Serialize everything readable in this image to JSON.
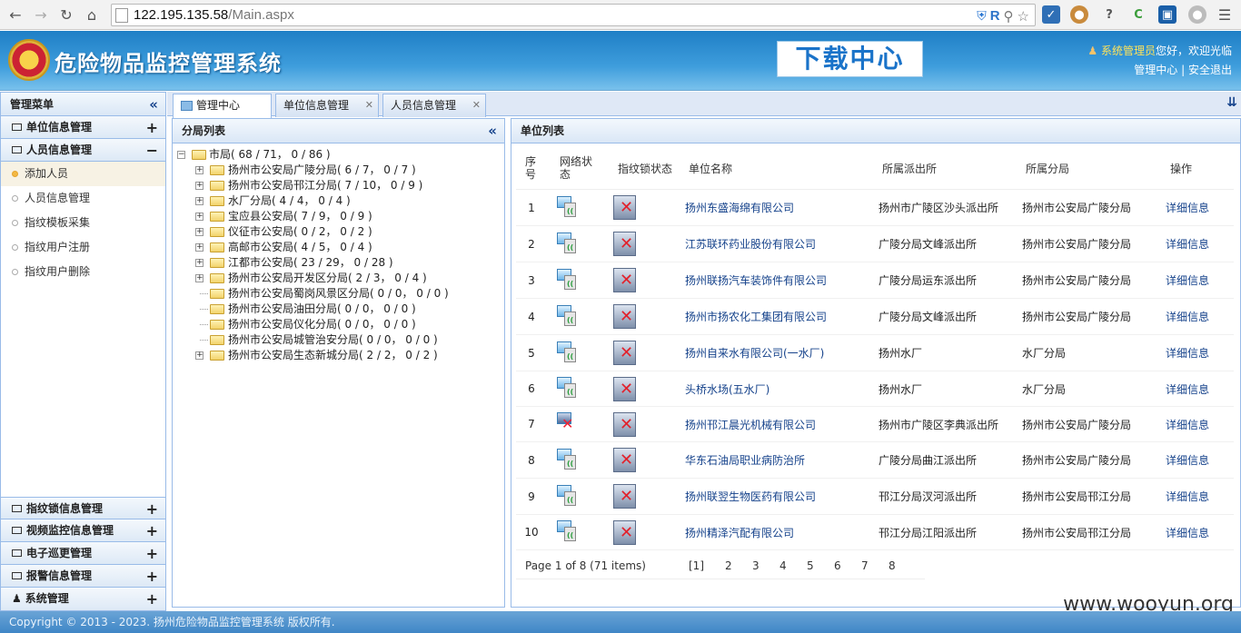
{
  "browser": {
    "url_host": "122.195.135.58",
    "url_path": "/Main.aspx"
  },
  "header": {
    "system_title": "危险物品监控管理系统",
    "download_center": "下载中心",
    "user_name": "系统管理员",
    "greeting": "您好，欢迎光临",
    "manage_center": "管理中心",
    "separator": "|",
    "logout": "安全退出"
  },
  "sidebar": {
    "title": "管理菜单",
    "sections": [
      {
        "label": "单位信息管理",
        "state": "+"
      },
      {
        "label": "人员信息管理",
        "state": "−"
      }
    ],
    "subitems": [
      "添加人员",
      "人员信息管理",
      "指纹模板采集",
      "指纹用户注册",
      "指纹用户删除"
    ],
    "bottom_sections": [
      {
        "label": "指纹锁信息管理",
        "state": "+"
      },
      {
        "label": "视频监控信息管理",
        "state": "+"
      },
      {
        "label": "电子巡更管理",
        "state": "+"
      },
      {
        "label": "报警信息管理",
        "state": "+"
      },
      {
        "label": "系统管理",
        "state": "+"
      }
    ]
  },
  "tabs": [
    {
      "label": "管理中心"
    },
    {
      "label": "单位信息管理"
    },
    {
      "label": "人员信息管理"
    }
  ],
  "tree_panel": {
    "title": "分局列表",
    "root": {
      "name": "市局",
      "counts": "( 68 / 71， 0 / 86 )"
    },
    "nodes": [
      {
        "name": "扬州市公安局广陵分局",
        "counts": "( 6 / 7， 0 / 7 )",
        "expandable": true
      },
      {
        "name": "扬州市公安局邗江分局",
        "counts": "( 7 / 10， 0 / 9 )",
        "expandable": true
      },
      {
        "name": "水厂分局",
        "counts": "( 4 / 4， 0 / 4 )",
        "expandable": true
      },
      {
        "name": "宝应县公安局",
        "counts": "( 7 / 9， 0 / 9 )",
        "expandable": true
      },
      {
        "name": "仪征市公安局",
        "counts": "( 0 / 2， 0 / 2 )",
        "expandable": true
      },
      {
        "name": "高邮市公安局",
        "counts": "( 4 / 5， 0 / 4 )",
        "expandable": true
      },
      {
        "name": "江都市公安局",
        "counts": "( 23 / 29， 0 / 28 )",
        "expandable": true
      },
      {
        "name": "扬州市公安局开发区分局",
        "counts": "( 2 / 3， 0 / 4 )",
        "expandable": true
      },
      {
        "name": "扬州市公安局蜀岗风景区分局",
        "counts": "( 0 / 0， 0 / 0 )",
        "expandable": false
      },
      {
        "name": "扬州市公安局油田分局",
        "counts": "( 0 / 0， 0 / 0 )",
        "expandable": false
      },
      {
        "name": "扬州市公安局仪化分局",
        "counts": "( 0 / 0， 0 / 0 )",
        "expandable": false
      },
      {
        "name": "扬州市公安局城管治安分局",
        "counts": "( 0 / 0， 0 / 0 )",
        "expandable": false
      },
      {
        "name": "扬州市公安局生态新城分局",
        "counts": "( 2 / 2， 0 / 2 )",
        "expandable": true
      }
    ]
  },
  "unit_panel": {
    "title": "单位列表",
    "columns": {
      "index": "序号",
      "network": "网络状态",
      "lock": "指纹锁状态",
      "name": "单位名称",
      "station": "所属派出所",
      "branch": "所属分局",
      "action": "操作"
    },
    "rows": [
      {
        "no": "1",
        "net": "online",
        "name": "扬州东盛海绵有限公司",
        "station": "扬州市广陵区沙头派出所",
        "branch": "扬州市公安局广陵分局",
        "action": "详细信息"
      },
      {
        "no": "2",
        "net": "online",
        "name": "江苏联环药业股份有限公司",
        "station": "广陵分局文峰派出所",
        "branch": "扬州市公安局广陵分局",
        "action": "详细信息"
      },
      {
        "no": "3",
        "net": "online",
        "name": "扬州联扬汽车装饰件有限公司",
        "station": "广陵分局运东派出所",
        "branch": "扬州市公安局广陵分局",
        "action": "详细信息"
      },
      {
        "no": "4",
        "net": "online",
        "name": "扬州市扬农化工集团有限公司",
        "station": "广陵分局文峰派出所",
        "branch": "扬州市公安局广陵分局",
        "action": "详细信息"
      },
      {
        "no": "5",
        "net": "online",
        "name": "扬州自来水有限公司(一水厂)",
        "station": "扬州水厂",
        "branch": "水厂分局",
        "action": "详细信息"
      },
      {
        "no": "6",
        "net": "online",
        "name": "头桥水场(五水厂)",
        "station": "扬州水厂",
        "branch": "水厂分局",
        "action": "详细信息"
      },
      {
        "no": "7",
        "net": "offline",
        "name": "扬州邗江晨光机械有限公司",
        "station": "扬州市广陵区李典派出所",
        "branch": "扬州市公安局广陵分局",
        "action": "详细信息"
      },
      {
        "no": "8",
        "net": "online",
        "name": "华东石油局职业病防治所",
        "station": "广陵分局曲江派出所",
        "branch": "扬州市公安局广陵分局",
        "action": "详细信息"
      },
      {
        "no": "9",
        "net": "online",
        "name": "扬州联翌生物医药有限公司",
        "station": "邗江分局汊河派出所",
        "branch": "扬州市公安局邗江分局",
        "action": "详细信息"
      },
      {
        "no": "10",
        "net": "online",
        "name": "扬州精泽汽配有限公司",
        "station": "邗江分局江阳派出所",
        "branch": "扬州市公安局邗江分局",
        "action": "详细信息"
      }
    ],
    "pager": {
      "summary": "Page 1 of 8 (71 items)",
      "pages": [
        "[1]",
        "2",
        "3",
        "4",
        "5",
        "6",
        "7",
        "8"
      ]
    }
  },
  "footer": {
    "copyright": "Copyright © 2013 - 2023. 扬州危险物品监控管理系统 版权所有."
  },
  "watermark": "www.wooyun.org"
}
